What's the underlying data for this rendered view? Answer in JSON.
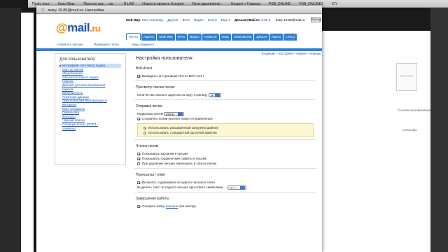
{
  "back_browser": {
    "tabs": [
      "Праїс лист",
      "Канс Юкм.",
      "Простое вас ... ula",
      "- R.LAB",
      "Новости проекта Ucmpert",
      "Рати appartments -",
      "Uexpert > Главная",
      "PSB_ONLINE",
      "PSB_ONLINE2",
      "ICY"
    ]
  },
  "window": {
    "title": "mary-19.85@mail.ru: Настройки"
  },
  "header": {
    "logo_main": "mail",
    "logo_tld": ".ru",
    "top_links": [
      "Мой Мир:",
      "Моя страница",
      "Друзья",
      "Фото",
      "Видео",
      "Блоги",
      "Еще ▾"
    ],
    "money_label": "Деньги@Mail.ru:",
    "money_value": "0.00 р.",
    "user_email": "mary-19.85@mail.ru",
    "exit_label": "Выход",
    "nav_tabs": [
      "Почта",
      "Адреса",
      "Мой Мир",
      "Фото",
      "Видео",
      "Новости",
      "Игры",
      "Знакомства",
      "Деньги",
      "Карты",
      "Leto.p"
    ]
  },
  "actions": {
    "write": "Написать письмо",
    "check": "Проверить почту",
    "new_folder": "Надо подумать",
    "breadcrumb": "входящие » настройки » червиче » помощь"
  },
  "sidebar": {
    "title": "Для пользователя",
    "items": [
      "Интерфейс почтового ящика",
      "Мастер писем",
      "Уведомления",
      "Объем почтового ящика",
      "Пароль",
      "Данные для восстановления",
      "пароля",
      "Безопасность",
      "Анкетные данные",
      "Персональная информация и",
      "интересы",
      "Мои телефоны",
      "Пересылка",
      "Фильтры",
      "Черный список",
      "Сборщик почты (POP3 -",
      "сервера)"
    ]
  },
  "main": {
    "title": "Настройка пользователя",
    "webagent": {
      "title": "Веб-Агент",
      "show_label": "Выводить на страницах Почты Веб-Агент"
    },
    "list_view": {
      "title": "Просмотр списка писем",
      "count_label": "Количество писем и адресов на одну страницу",
      "count_value": "25"
    },
    "sending": {
      "title": "Отправка писем",
      "encoding_label": "Кодировка писем",
      "encoding_value": "KOI-8",
      "save_copies_label": "Сохранять копии писем в папке Отправленные",
      "uploader_advanced": "Использовать расширенный загрузчик файлов",
      "uploader_standard": "Использовать стандартный загрузчик файлов"
    },
    "reading": {
      "title": "Чтение писем",
      "show_images": "Показывать картинки в письме",
      "show_smiles": "Показывать графические смайлы в письме",
      "goto_list": "При удалении письма переходить в список писем"
    },
    "forward": {
      "title": "Пересылка / ответ",
      "include_original": "Включать содержимое исходного письма в ответ",
      "quote_label": "Выделять текст исходного письма при ответе символами",
      "quote_value": "\"> \""
    },
    "finish": {
      "title": "Завершение работы",
      "clear_prefix": "Очищать папку",
      "clear_link": "Корзина",
      "clear_suffix": "при выходе"
    }
  },
  "right_page": {
    "lines": [
      "Ссылка на изменения",
      "Стиль Вы"
    ],
    "avatar_caption": "NO PHOTO"
  }
}
